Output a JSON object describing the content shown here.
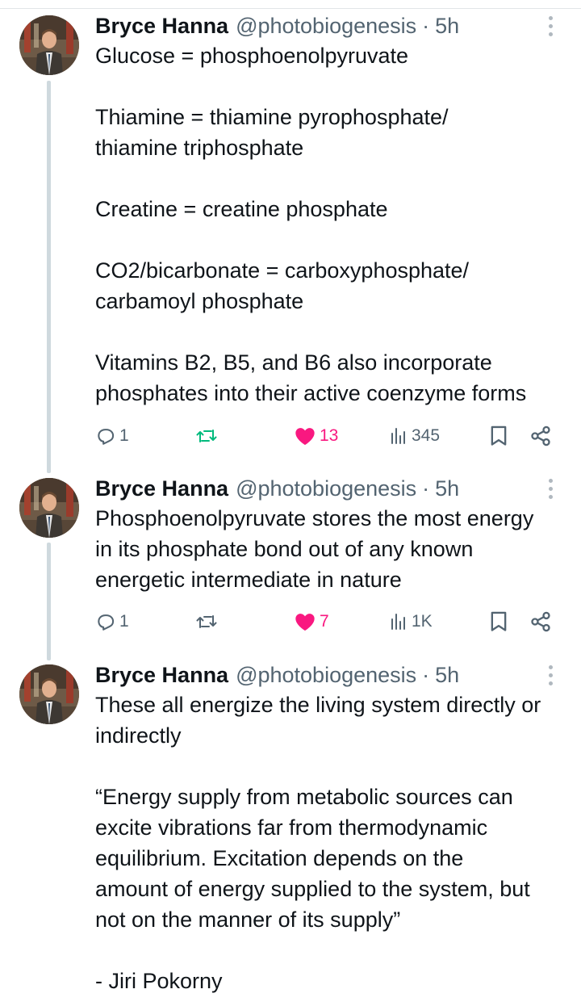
{
  "tweets": [
    {
      "name": "Bryce Hanna",
      "handle": "@photobiogenesis",
      "separator": "·",
      "time": "5h",
      "text": "Glucose = phosphoenolpyruvate\n\nThiamine = thiamine pyrophosphate/\nthiamine triphosphate\n\nCreatine = creatine phosphate\n\nCO2/bicarbonate = carboxyphosphate/\ncarbamoyl phosphate\n\nVitamins B2, B5, and B6 also incorporate\nphosphates into their active coenzyme forms",
      "replies": "1",
      "likes": "13",
      "liked": true,
      "views": "345"
    },
    {
      "name": "Bryce Hanna",
      "handle": "@photobiogenesis",
      "separator": "·",
      "time": "5h",
      "text": "Phosphoenolpyruvate stores the most energy\nin its phosphate bond out of any known\nenergetic intermediate in nature",
      "replies": "1",
      "likes": "7",
      "liked": true,
      "views": "1K"
    },
    {
      "name": "Bryce Hanna",
      "handle": "@photobiogenesis",
      "separator": "·",
      "time": "5h",
      "text": "These all energize the living system directly or\nindirectly\n\n“Energy supply from metabolic sources can\nexcite vibrations far from thermodynamic\nequilibrium. Excitation depends on the\namount of energy supplied to the system, but\nnot on the manner of its supply”\n\n- Jiri Pokorny"
    }
  ],
  "colors": {
    "text": "#0f1419",
    "muted": "#536471",
    "like": "#f91880",
    "retweet": "#00ba7c",
    "thread_line": "#cfd9de"
  },
  "icons": [
    "reply-icon",
    "retweet-icon",
    "like-icon",
    "views-icon",
    "bookmark-icon",
    "share-icon",
    "more-options-icon"
  ]
}
